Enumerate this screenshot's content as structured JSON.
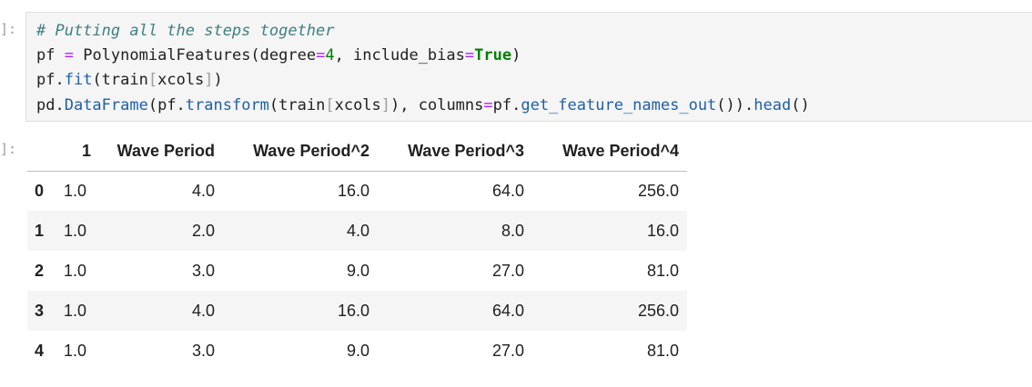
{
  "in_prompt": "]:",
  "out_prompt": "]:",
  "code": {
    "comment": "# Putting all the steps together",
    "line2": {
      "var": "pf",
      "eq": " = ",
      "call": "PolynomialFeatures(degree",
      "kw_eq": "=",
      "degree": "4",
      "mid": ", include_bias",
      "kw_eq2": "=",
      "true": "True",
      "close": ")"
    },
    "line3": {
      "obj": "pf.",
      "method": "fit",
      "open": "(train",
      "lb": "[",
      "arg": "xcols",
      "rb": "]",
      "close": ")"
    },
    "line4": {
      "obj": "pd.",
      "cls": "DataFrame",
      "p1": "(pf.",
      "m1": "transform",
      "p2": "(train",
      "lb": "[",
      "arg": "xcols",
      "rb": "]",
      "p3": "), columns",
      "eq": "=",
      "p4": "pf.",
      "m2": "get_feature_names_out",
      "p5": "()).",
      "m3": "head",
      "p6": "()"
    }
  },
  "table": {
    "columns": [
      "",
      "1",
      "Wave Period",
      "Wave Period^2",
      "Wave Period^3",
      "Wave Period^4"
    ],
    "rows": [
      {
        "index": "0",
        "cells": [
          "1.0",
          "4.0",
          "16.0",
          "64.0",
          "256.0"
        ]
      },
      {
        "index": "1",
        "cells": [
          "1.0",
          "2.0",
          "4.0",
          "8.0",
          "16.0"
        ]
      },
      {
        "index": "2",
        "cells": [
          "1.0",
          "3.0",
          "9.0",
          "27.0",
          "81.0"
        ]
      },
      {
        "index": "3",
        "cells": [
          "1.0",
          "4.0",
          "16.0",
          "64.0",
          "256.0"
        ]
      },
      {
        "index": "4",
        "cells": [
          "1.0",
          "3.0",
          "9.0",
          "27.0",
          "81.0"
        ]
      }
    ]
  }
}
